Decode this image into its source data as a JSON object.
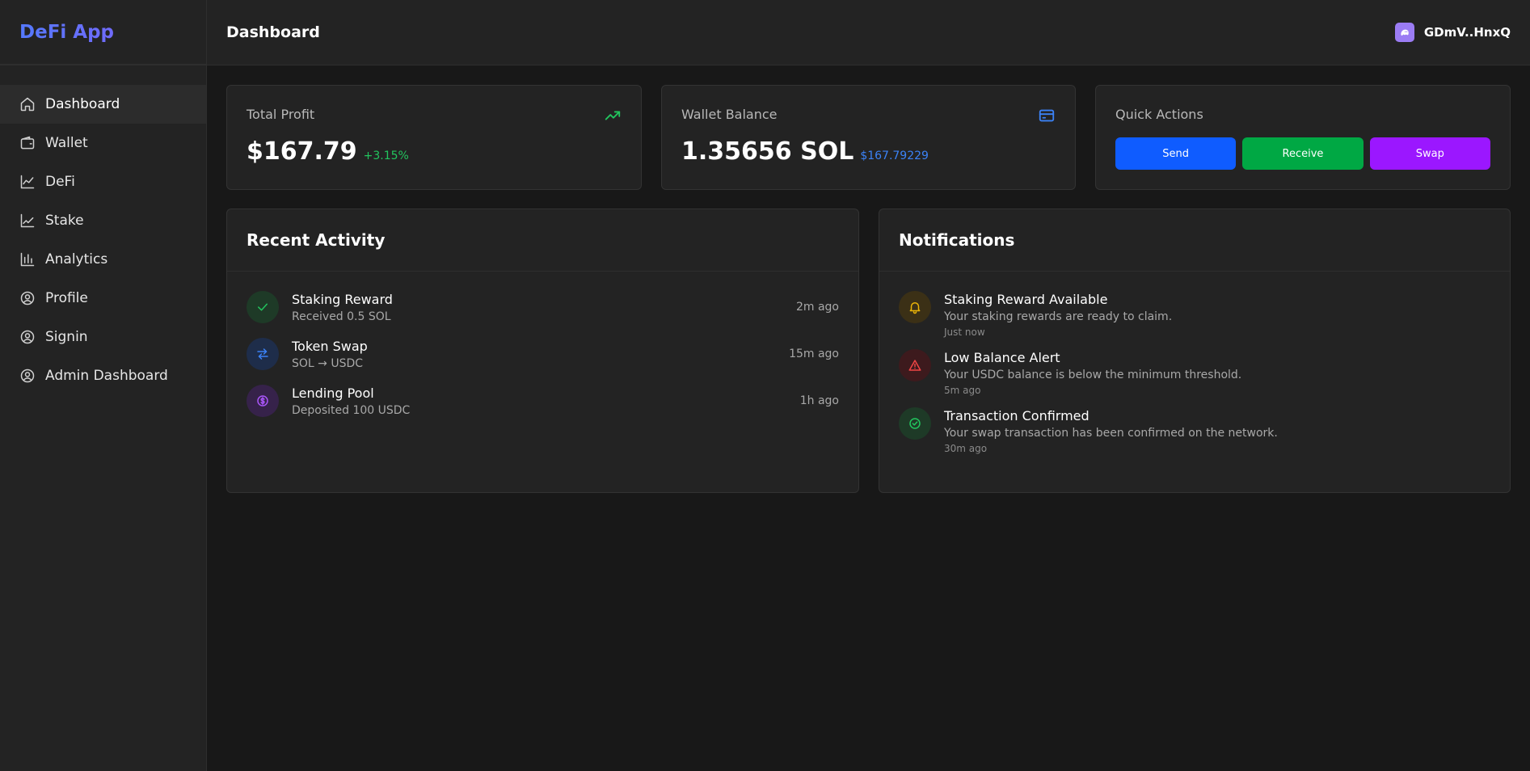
{
  "app": {
    "title": "DeFi App"
  },
  "sidebar": {
    "items": [
      {
        "label": "Dashboard",
        "icon": "home-icon"
      },
      {
        "label": "Wallet",
        "icon": "wallet-icon"
      },
      {
        "label": "DeFi",
        "icon": "trend-icon"
      },
      {
        "label": "Stake",
        "icon": "chart-line-icon"
      },
      {
        "label": "Analytics",
        "icon": "bar-chart-icon"
      },
      {
        "label": "Profile",
        "icon": "user-circle-icon"
      },
      {
        "label": "Signin",
        "icon": "user-circle-icon"
      },
      {
        "label": "Admin Dashboard",
        "icon": "user-circle-icon"
      }
    ]
  },
  "header": {
    "title": "Dashboard",
    "wallet_address": "GDmV..HnxQ"
  },
  "stats": {
    "profit": {
      "label": "Total Profit",
      "value": "$167.79",
      "change": "+3.15%"
    },
    "balance": {
      "label": "Wallet Balance",
      "value": "1.35656 SOL",
      "usd": "$167.79229"
    }
  },
  "quick_actions": {
    "title": "Quick Actions",
    "send": "Send",
    "receive": "Receive",
    "swap": "Swap"
  },
  "activity": {
    "title": "Recent Activity",
    "items": [
      {
        "title": "Staking Reward",
        "subtitle": "Received 0.5 SOL",
        "time": "2m ago"
      },
      {
        "title": "Token Swap",
        "subtitle": "SOL → USDC",
        "time": "15m ago"
      },
      {
        "title": "Lending Pool",
        "subtitle": "Deposited 100 USDC",
        "time": "1h ago"
      }
    ]
  },
  "notifications": {
    "title": "Notifications",
    "items": [
      {
        "title": "Staking Reward Available",
        "message": "Your staking rewards are ready to claim.",
        "time": "Just now"
      },
      {
        "title": "Low Balance Alert",
        "message": "Your USDC balance is below the minimum threshold.",
        "time": "5m ago"
      },
      {
        "title": "Transaction Confirmed",
        "message": "Your swap transaction has been confirmed on the network.",
        "time": "30m ago"
      }
    ]
  },
  "colors": {
    "accent_blue": "#0f5cff",
    "green": "#00a844",
    "purple": "#9b17ff"
  }
}
